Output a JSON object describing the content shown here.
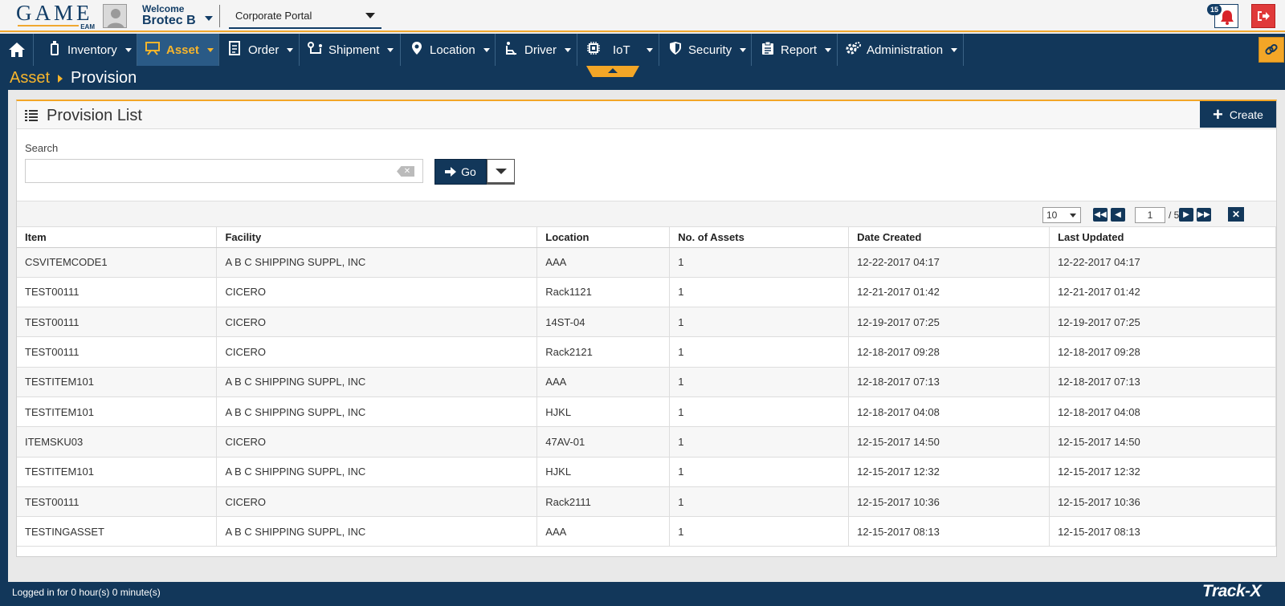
{
  "header": {
    "logo_text": "GAME",
    "logo_sub": "EAM",
    "welcome_label": "Welcome",
    "username": "Brotec B",
    "portal_selected": "Corporate Portal",
    "notification_count": "15"
  },
  "nav": {
    "items": [
      {
        "label": "Inventory",
        "icon": "inventory-icon"
      },
      {
        "label": "Asset",
        "icon": "asset-icon",
        "active": true
      },
      {
        "label": "Order",
        "icon": "order-icon"
      },
      {
        "label": "Shipment",
        "icon": "shipment-icon"
      },
      {
        "label": "Location",
        "icon": "location-pin-icon"
      },
      {
        "label": "Driver",
        "icon": "driver-icon"
      },
      {
        "label": "IoT",
        "icon": "chip-icon"
      },
      {
        "label": "Security",
        "icon": "shield-icon"
      },
      {
        "label": "Report",
        "icon": "clipboard-icon"
      },
      {
        "label": "Administration",
        "icon": "gears-icon"
      }
    ]
  },
  "breadcrumb": {
    "parent": "Asset",
    "current": "Provision"
  },
  "panel": {
    "title": "Provision List",
    "create_label": "Create",
    "search_label": "Search",
    "search_value": "",
    "go_label": "Go"
  },
  "pagination": {
    "page_size": "10",
    "current_page": "1",
    "total_label": "/ 5"
  },
  "table": {
    "columns": [
      "Item",
      "Facility",
      "Location",
      "No. of Assets",
      "Date Created",
      "Last Updated"
    ],
    "rows": [
      [
        "CSVITEMCODE1",
        "A B C SHIPPING SUPPL, INC",
        "AAA",
        "1",
        "12-22-2017 04:17",
        "12-22-2017 04:17"
      ],
      [
        "TEST00111",
        "CICERO",
        "Rack1121",
        "1",
        "12-21-2017 01:42",
        "12-21-2017 01:42"
      ],
      [
        "TEST00111",
        "CICERO",
        "14ST-04",
        "1",
        "12-19-2017 07:25",
        "12-19-2017 07:25"
      ],
      [
        "TEST00111",
        "CICERO",
        "Rack2121",
        "1",
        "12-18-2017 09:28",
        "12-18-2017 09:28"
      ],
      [
        "TESTITEM101",
        "A B C SHIPPING SUPPL, INC",
        "AAA",
        "1",
        "12-18-2017 07:13",
        "12-18-2017 07:13"
      ],
      [
        "TESTITEM101",
        "A B C SHIPPING SUPPL, INC",
        "HJKL",
        "1",
        "12-18-2017 04:08",
        "12-18-2017 04:08"
      ],
      [
        "ITEMSKU03",
        "CICERO",
        "47AV-01",
        "1",
        "12-15-2017 14:50",
        "12-15-2017 14:50"
      ],
      [
        "TESTITEM101",
        "A B C SHIPPING SUPPL, INC",
        "HJKL",
        "1",
        "12-15-2017 12:32",
        "12-15-2017 12:32"
      ],
      [
        "TEST00111",
        "CICERO",
        "Rack2111",
        "1",
        "12-15-2017 10:36",
        "12-15-2017 10:36"
      ],
      [
        "TESTINGASSET",
        "A B C SHIPPING SUPPL, INC",
        "AAA",
        "1",
        "12-15-2017 08:13",
        "12-15-2017 08:13"
      ]
    ]
  },
  "footer": {
    "status": "Logged in for 0 hour(s) 0 minute(s)",
    "brand": "Track-X"
  },
  "colors": {
    "navy": "#12375a",
    "accent": "#f3a627",
    "alert": "#e03a3a"
  }
}
